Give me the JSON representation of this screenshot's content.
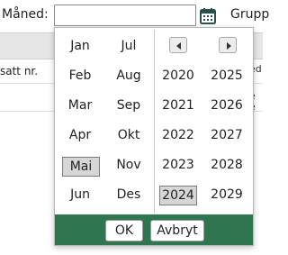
{
  "filter": {
    "month_label": "Måned:",
    "month_value": "",
    "group_label": "Grupp"
  },
  "table": {
    "column_header": "satt nr.",
    "right_fragments": [
      "ed",
      "e",
      "e"
    ]
  },
  "picker": {
    "months": [
      "Jan",
      "Feb",
      "Mar",
      "Apr",
      "Mai",
      "Jun",
      "Jul",
      "Aug",
      "Sep",
      "Okt",
      "Nov",
      "Des"
    ],
    "selected_month": "Mai",
    "years": [
      "2020",
      "2021",
      "2022",
      "2023",
      "2024",
      "2025",
      "2026",
      "2027",
      "2028",
      "2029"
    ],
    "selected_year": "2024",
    "ok_label": "OK",
    "cancel_label": "Avbryt",
    "prev_icon": "triangle-left-icon",
    "next_icon": "triangle-right-icon",
    "footer_color": "#2f7550",
    "selection_color": "#d6d6d6"
  }
}
